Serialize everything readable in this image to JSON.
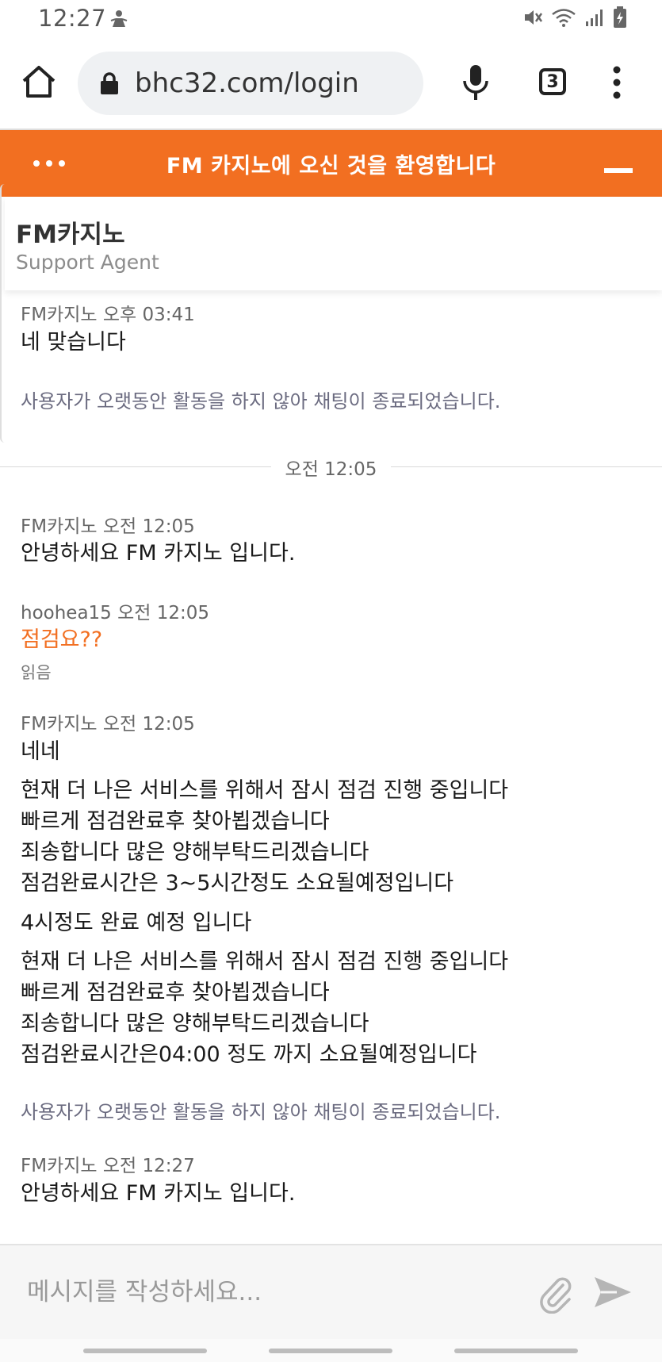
{
  "status_bar": {
    "time": "12:27"
  },
  "browser": {
    "url": "bhc32.com/login",
    "tab_count": "3"
  },
  "chat_header": {
    "title": "FM 카지노에 오신 것을 환영합니다"
  },
  "agent": {
    "name": "FM카지노",
    "role": "Support Agent"
  },
  "messages": {
    "m1_meta": "FM카지노 오후 03:41",
    "m1_text": "네 맞습니다",
    "notice1": "사용자가 오랫동안 활동을 하지 않아 채팅이 종료되었습니다.",
    "day_divider": "오전 12:05",
    "m2_meta": "FM카지노 오전 12:05",
    "m2_text": "안녕하세요 FM 카지노 입니다.",
    "m3_meta": "hoohea15 오전 12:05",
    "m3_text": "점검요??",
    "m3_read": "읽음",
    "m4_meta": "FM카지노 오전 12:05",
    "m4_line1": "네네",
    "m4_block1": [
      "현재 더 나은 서비스를 위해서 잠시 점검 진행 중입니다",
      "빠르게 점검완료후 찾아뵙겠습니다",
      "죄송합니다 많은 양해부탁드리겠습니다",
      "점검완료시간은 3~5시간정도 소요될예정입니다"
    ],
    "m4_line2": "4시정도 완료 예정 입니다",
    "m4_block2": [
      "현재 더 나은 서비스를 위해서 잠시 점검 진행 중입니다",
      "빠르게 점검완료후 찾아뵙겠습니다",
      "죄송합니다 많은 양해부탁드리겠습니다",
      "점검완료시간은04:00 정도 까지 소요될예정입니다"
    ],
    "notice2": "사용자가 오랫동안 활동을 하지 않아 채팅이 종료되었습니다.",
    "m5_meta": "FM카지노 오전 12:27",
    "m5_text": "안녕하세요 FM 카지노 입니다."
  },
  "input": {
    "placeholder": "메시지를 작성하세요..."
  },
  "colors": {
    "accent": "#f26f21",
    "notice": "#6b6b80"
  },
  "icons": [
    "silent-icon",
    "wifi-icon",
    "signal-icon",
    "battery-icon",
    "home-icon",
    "lock-icon",
    "mic-icon",
    "tabs-icon",
    "more-vert-icon",
    "dots-icon",
    "minimize-icon",
    "attach-icon",
    "send-icon"
  ]
}
